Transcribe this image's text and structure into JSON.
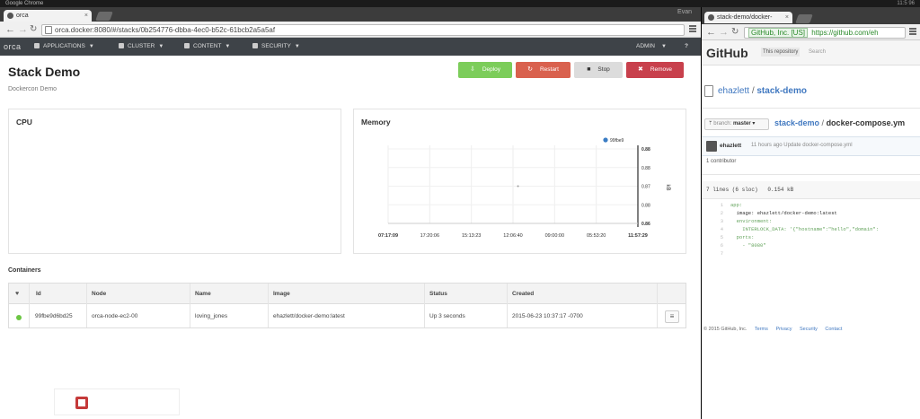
{
  "os": {
    "app_name": "Google Chrome",
    "status": "11:5 96"
  },
  "left_browser": {
    "tab_title": "orca",
    "tab_close": "×",
    "url": "orca.docker:8080/#/stacks/0b254776-dbba-4ec0-b52c-61bcb2a5a5af",
    "window_label": "Evan"
  },
  "orca_nav": {
    "brand": "orca",
    "items": [
      {
        "label": "APPLICATIONS",
        "icon": "apps-icon"
      },
      {
        "label": "CLUSTER",
        "icon": "cluster-icon"
      },
      {
        "label": "CONTENT",
        "icon": "content-icon"
      },
      {
        "label": "SECURITY",
        "icon": "lock-icon"
      }
    ],
    "user": "ADMIN",
    "help": "?"
  },
  "stack": {
    "title": "Stack Demo",
    "subtitle": "Dockercon Demo",
    "buttons": {
      "deploy": "Deploy",
      "restart": "Restart",
      "stop": "Stop",
      "remove": "Remove"
    },
    "colors": {
      "deploy": "#7ccd5a",
      "restart": "#d9614e",
      "stop": "#dcdcdc",
      "remove": "#c8404c"
    }
  },
  "panels": {
    "cpu_title": "CPU",
    "memory_title": "Memory"
  },
  "chart_data": {
    "type": "line",
    "series": [
      {
        "name": "99fbe9",
        "values": [
          0.87
        ]
      }
    ],
    "x": [
      "07:17:09",
      "17:20:06",
      "15:13:23",
      "12:06:40",
      "09:00:00",
      "05:53:20",
      "11:57:29"
    ],
    "y_ticks": [
      "0.88",
      "0.88",
      "0.87",
      "0.88",
      "0.86"
    ],
    "ylabel": "kB",
    "legend_position": "top-right",
    "series_color": "#3b7dc4"
  },
  "containers": {
    "label": "Containers",
    "headers": {
      "health": "♥",
      "id": "Id",
      "node": "Node",
      "name": "Name",
      "image": "Image",
      "status": "Status",
      "created": "Created"
    },
    "rows": [
      {
        "id": "99fbe9d6bd25",
        "node": "orca-node-ec2-00",
        "name": "loving_jones",
        "image": "ehazlett/docker-demo:latest",
        "status": "Up 3 seconds",
        "created": "2015-06-23 10:37:17 -0700",
        "health_color": "#6cc644"
      }
    ]
  },
  "right_browser": {
    "tab_title": "stack-demo/docker-",
    "tab_close": "×",
    "secure_label": "GitHub, Inc. [US]",
    "url": "https://github.com/eh",
    "gh_logo": "GitHub",
    "gh_search_scope": "This repository",
    "gh_search_placeholder": "Search",
    "owner": "ehazlett",
    "repo": "stack-demo",
    "branch_label": "branch:",
    "branch": "master",
    "path_repo": "stack-demo",
    "path_file": "docker-compose.ym",
    "commit_author": "ehazlett",
    "commit_message": "11 hours ago Update docker-compose.yml",
    "contributors": "1 contributor",
    "file_meta": "7 lines (6 sloc)   0.154 kB",
    "code_lines": [
      {
        "n": "1",
        "t": "app:"
      },
      {
        "n": "2",
        "t": "  image: ehazlett/docker-demo:latest"
      },
      {
        "n": "3",
        "t": "  environment:"
      },
      {
        "n": "4",
        "t": "    INTERLOCK_DATA: '{\"hostname\":\"hello\",\"domain\":"
      },
      {
        "n": "5",
        "t": "  ports:"
      },
      {
        "n": "6",
        "t": "    - \"8080\""
      },
      {
        "n": "7",
        "t": ""
      }
    ],
    "footer": [
      "© 2015 GitHub, Inc.",
      "Terms",
      "Privacy",
      "Security",
      "Contact"
    ]
  }
}
